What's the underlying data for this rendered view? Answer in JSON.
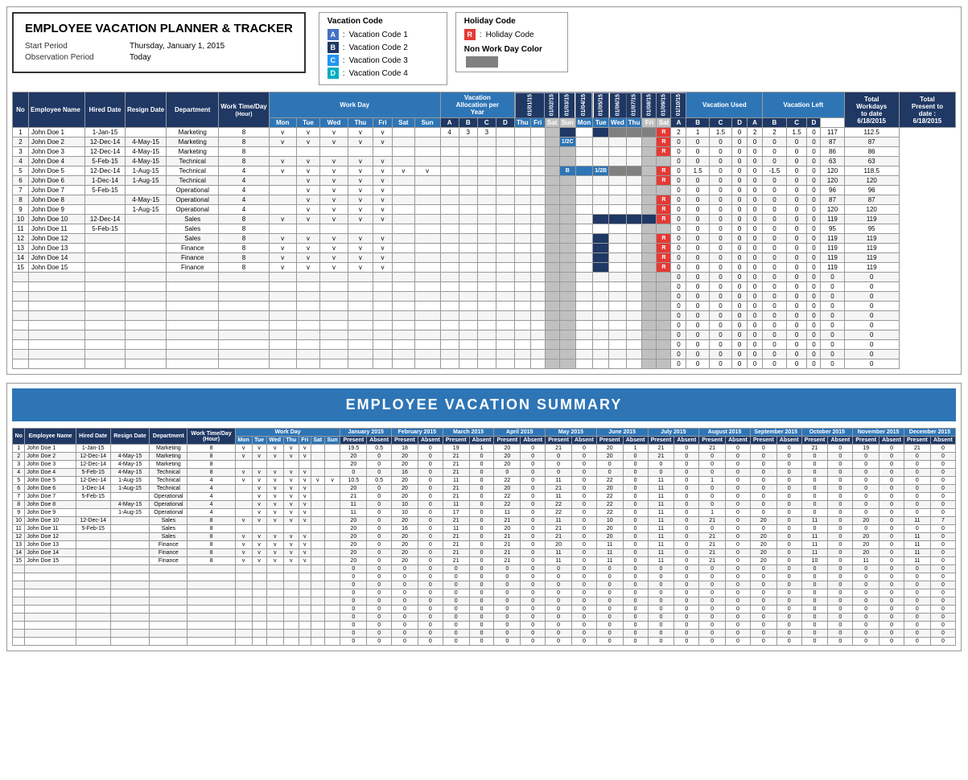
{
  "header": {
    "title": "EMPLOYEE VACATION PLANNER & TRACKER",
    "start_period_label": "Start Period",
    "start_period_value": "Thursday, January 1, 2015",
    "obs_period_label": "Observation Period",
    "obs_period_value": "Today"
  },
  "vacation_legend": {
    "title": "Vacation Code",
    "items": [
      {
        "code": "A",
        "label": "Vacation Code 1"
      },
      {
        "code": "B",
        "label": "Vacation Code 2"
      },
      {
        "code": "C",
        "label": "Vacation Code 3"
      },
      {
        "code": "D",
        "label": "Vacation Code 4"
      }
    ]
  },
  "holiday_legend": {
    "title": "Holiday Code",
    "items": [
      {
        "code": "R",
        "label": "Holiday Code"
      }
    ],
    "non_work_label": "Non Work Day Color"
  },
  "columns": {
    "no": "No",
    "employee_name": "Employee Name",
    "hired_date": "Hired Date",
    "resign_date": "Resign Date",
    "department": "Department",
    "work_time_day": "Work Time/Day",
    "work_day": "Work Day",
    "vacation_allocation": "Vacation Allocation per Year",
    "vacation_used": "Vacation Used",
    "vacation_left": "Vacation Left",
    "total_workdays": "Total Workdays to date",
    "total_present": "Total Present to date :"
  },
  "employees": [
    {
      "no": 1,
      "name": "John Doe 1",
      "hired": "1-Jan-15",
      "resign": "",
      "dept": "Marketing",
      "work": 8,
      "mon": "v",
      "tue": "v",
      "wed": "v",
      "thu": "v",
      "fri": "v",
      "sat": "",
      "sun": "",
      "vac_a": 4,
      "vac_b": 3,
      "vac_c": 3,
      "vac_d": "",
      "used_a": 2,
      "used_b": 1,
      "used_c": 1.5,
      "used_d": 0,
      "left_a": 2,
      "left_b": 2,
      "left_c": 1.5,
      "left_d": 0,
      "total_work": 117,
      "total_present": 112.5
    },
    {
      "no": 2,
      "name": "John Doe 2",
      "hired": "12-Dec-14",
      "resign": "4-May-15",
      "dept": "Marketing",
      "work": 8,
      "mon": "v",
      "tue": "v",
      "wed": "v",
      "thu": "v",
      "fri": "v",
      "sat": "",
      "sun": "",
      "vac_a": "",
      "vac_b": "",
      "vac_c": "",
      "vac_d": "",
      "used_a": 0,
      "used_b": 0,
      "used_c": 0,
      "used_d": 0,
      "left_a": 0,
      "left_b": 0,
      "left_c": 0,
      "left_d": 0,
      "total_work": 87,
      "total_present": 87
    },
    {
      "no": 3,
      "name": "John Doe 3",
      "hired": "12-Dec-14",
      "resign": "4-May-15",
      "dept": "Marketing",
      "work": 8,
      "mon": "",
      "tue": "",
      "wed": "",
      "thu": "",
      "fri": "",
      "sat": "",
      "sun": "",
      "vac_a": "",
      "vac_b": "",
      "vac_c": "",
      "vac_d": "",
      "used_a": 0,
      "used_b": 0,
      "used_c": 0,
      "used_d": 0,
      "left_a": 0,
      "left_b": 0,
      "left_c": 0,
      "left_d": 0,
      "total_work": 86,
      "total_present": 86
    },
    {
      "no": 4,
      "name": "John Doe 4",
      "hired": "5-Feb-15",
      "resign": "4-May-15",
      "dept": "Technical",
      "work": 8,
      "mon": "v",
      "tue": "v",
      "wed": "v",
      "thu": "v",
      "fri": "v",
      "sat": "",
      "sun": "",
      "vac_a": "",
      "vac_b": "",
      "vac_c": "",
      "vac_d": "",
      "used_a": 0,
      "used_b": 0,
      "used_c": 0,
      "used_d": 0,
      "left_a": 0,
      "left_b": 0,
      "left_c": 0,
      "left_d": 0,
      "total_work": 63,
      "total_present": 63
    },
    {
      "no": 5,
      "name": "John Doe 5",
      "hired": "12-Dec-14",
      "resign": "1-Aug-15",
      "dept": "Technical",
      "work": 4,
      "mon": "v",
      "tue": "v",
      "wed": "v",
      "thu": "v",
      "fri": "v",
      "sat": "v",
      "sun": "v",
      "vac_a": "",
      "vac_b": "",
      "vac_c": "",
      "vac_d": "",
      "used_a": 0,
      "used_b": 1.5,
      "used_c": 0,
      "used_d": 0,
      "left_a": 0,
      "left_b": -1.5,
      "left_c": 0,
      "left_d": 0,
      "total_work": 120,
      "total_present": 118.5
    },
    {
      "no": 6,
      "name": "John Doe 6",
      "hired": "1-Dec-14",
      "resign": "1-Aug-15",
      "dept": "Technical",
      "work": 4,
      "mon": "",
      "tue": "v",
      "wed": "v",
      "thu": "v",
      "fri": "v",
      "sat": "",
      "sun": "",
      "vac_a": "",
      "vac_b": "",
      "vac_c": "",
      "vac_d": "",
      "used_a": 0,
      "used_b": 0,
      "used_c": 0,
      "used_d": 0,
      "left_a": 0,
      "left_b": 0,
      "left_c": 0,
      "left_d": 0,
      "total_work": 120,
      "total_present": 120
    },
    {
      "no": 7,
      "name": "John Doe 7",
      "hired": "5-Feb-15",
      "resign": "",
      "dept": "Operational",
      "work": 4,
      "mon": "",
      "tue": "v",
      "wed": "v",
      "thu": "v",
      "fri": "v",
      "sat": "",
      "sun": "",
      "vac_a": "",
      "vac_b": "",
      "vac_c": "",
      "vac_d": "",
      "used_a": 0,
      "used_b": 0,
      "used_c": 0,
      "used_d": 0,
      "left_a": 0,
      "left_b": 0,
      "left_c": 0,
      "left_d": 0,
      "total_work": 96,
      "total_present": 96
    },
    {
      "no": 8,
      "name": "John Doe 8",
      "hired": "",
      "resign": "4-May-15",
      "dept": "Operational",
      "work": 4,
      "mon": "",
      "tue": "v",
      "wed": "v",
      "thu": "v",
      "fri": "v",
      "sat": "",
      "sun": "",
      "vac_a": "",
      "vac_b": "",
      "vac_c": "",
      "vac_d": "",
      "used_a": 0,
      "used_b": 0,
      "used_c": 0,
      "used_d": 0,
      "left_a": 0,
      "left_b": 0,
      "left_c": 0,
      "left_d": 0,
      "total_work": 87,
      "total_present": 87
    },
    {
      "no": 9,
      "name": "John Doe 9",
      "hired": "",
      "resign": "1-Aug-15",
      "dept": "Operational",
      "work": 4,
      "mon": "",
      "tue": "v",
      "wed": "v",
      "thu": "v",
      "fri": "v",
      "sat": "",
      "sun": "",
      "vac_a": "",
      "vac_b": "",
      "vac_c": "",
      "vac_d": "",
      "used_a": 0,
      "used_b": 0,
      "used_c": 0,
      "used_d": 0,
      "left_a": 0,
      "left_b": 0,
      "left_c": 0,
      "left_d": 0,
      "total_work": 120,
      "total_present": 120
    },
    {
      "no": 10,
      "name": "John Doe 10",
      "hired": "12-Dec-14",
      "resign": "",
      "dept": "Sales",
      "work": 8,
      "mon": "v",
      "tue": "v",
      "wed": "v",
      "thu": "v",
      "fri": "v",
      "sat": "",
      "sun": "",
      "vac_a": "",
      "vac_b": "",
      "vac_c": "",
      "vac_d": "",
      "used_a": 0,
      "used_b": 0,
      "used_c": 0,
      "used_d": 0,
      "left_a": 0,
      "left_b": 0,
      "left_c": 0,
      "left_d": 0,
      "total_work": 119,
      "total_present": 119
    },
    {
      "no": 11,
      "name": "John Doe 11",
      "hired": "5-Feb-15",
      "resign": "",
      "dept": "Sales",
      "work": 8,
      "mon": "",
      "tue": "",
      "wed": "",
      "thu": "",
      "fri": "",
      "sat": "",
      "sun": "",
      "vac_a": "",
      "vac_b": "",
      "vac_c": "",
      "vac_d": "",
      "used_a": 0,
      "used_b": 0,
      "used_c": 0,
      "used_d": 0,
      "left_a": 0,
      "left_b": 0,
      "left_c": 0,
      "left_d": 0,
      "total_work": 95,
      "total_present": 95
    },
    {
      "no": 12,
      "name": "John Doe 12",
      "hired": "",
      "resign": "",
      "dept": "Sales",
      "work": 8,
      "mon": "v",
      "tue": "v",
      "wed": "v",
      "thu": "v",
      "fri": "v",
      "sat": "",
      "sun": "",
      "vac_a": "",
      "vac_b": "",
      "vac_c": "",
      "vac_d": "",
      "used_a": 0,
      "used_b": 0,
      "used_c": 0,
      "used_d": 0,
      "left_a": 0,
      "left_b": 0,
      "left_c": 0,
      "left_d": 0,
      "total_work": 119,
      "total_present": 119
    },
    {
      "no": 13,
      "name": "John Doe 13",
      "hired": "",
      "resign": "",
      "dept": "Finance",
      "work": 8,
      "mon": "v",
      "tue": "v",
      "wed": "v",
      "thu": "v",
      "fri": "v",
      "sat": "",
      "sun": "",
      "vac_a": "",
      "vac_b": "",
      "vac_c": "",
      "vac_d": "",
      "used_a": 0,
      "used_b": 0,
      "used_c": 0,
      "used_d": 0,
      "left_a": 0,
      "left_b": 0,
      "left_c": 0,
      "left_d": 0,
      "total_work": 119,
      "total_present": 119
    },
    {
      "no": 14,
      "name": "John Doe 14",
      "hired": "",
      "resign": "",
      "dept": "Finance",
      "work": 8,
      "mon": "v",
      "tue": "v",
      "wed": "v",
      "thu": "v",
      "fri": "v",
      "sat": "",
      "sun": "",
      "vac_a": "",
      "vac_b": "",
      "vac_c": "",
      "vac_d": "",
      "used_a": 0,
      "used_b": 0,
      "used_c": 0,
      "used_d": 0,
      "left_a": 0,
      "left_b": 0,
      "left_c": 0,
      "left_d": 0,
      "total_work": 119,
      "total_present": 119
    },
    {
      "no": 15,
      "name": "John Doe 15",
      "hired": "",
      "resign": "",
      "dept": "Finance",
      "work": 8,
      "mon": "v",
      "tue": "v",
      "wed": "v",
      "thu": "v",
      "fri": "v",
      "sat": "",
      "sun": "",
      "vac_a": "",
      "vac_b": "",
      "vac_c": "",
      "vac_d": "",
      "used_a": 0,
      "used_b": 0,
      "used_c": 0,
      "used_d": 0,
      "left_a": 0,
      "left_b": 0,
      "left_c": 0,
      "left_d": 0,
      "total_work": 119,
      "total_present": 119
    }
  ],
  "summary": {
    "title": "EMPLOYEE VACATION SUMMARY"
  }
}
